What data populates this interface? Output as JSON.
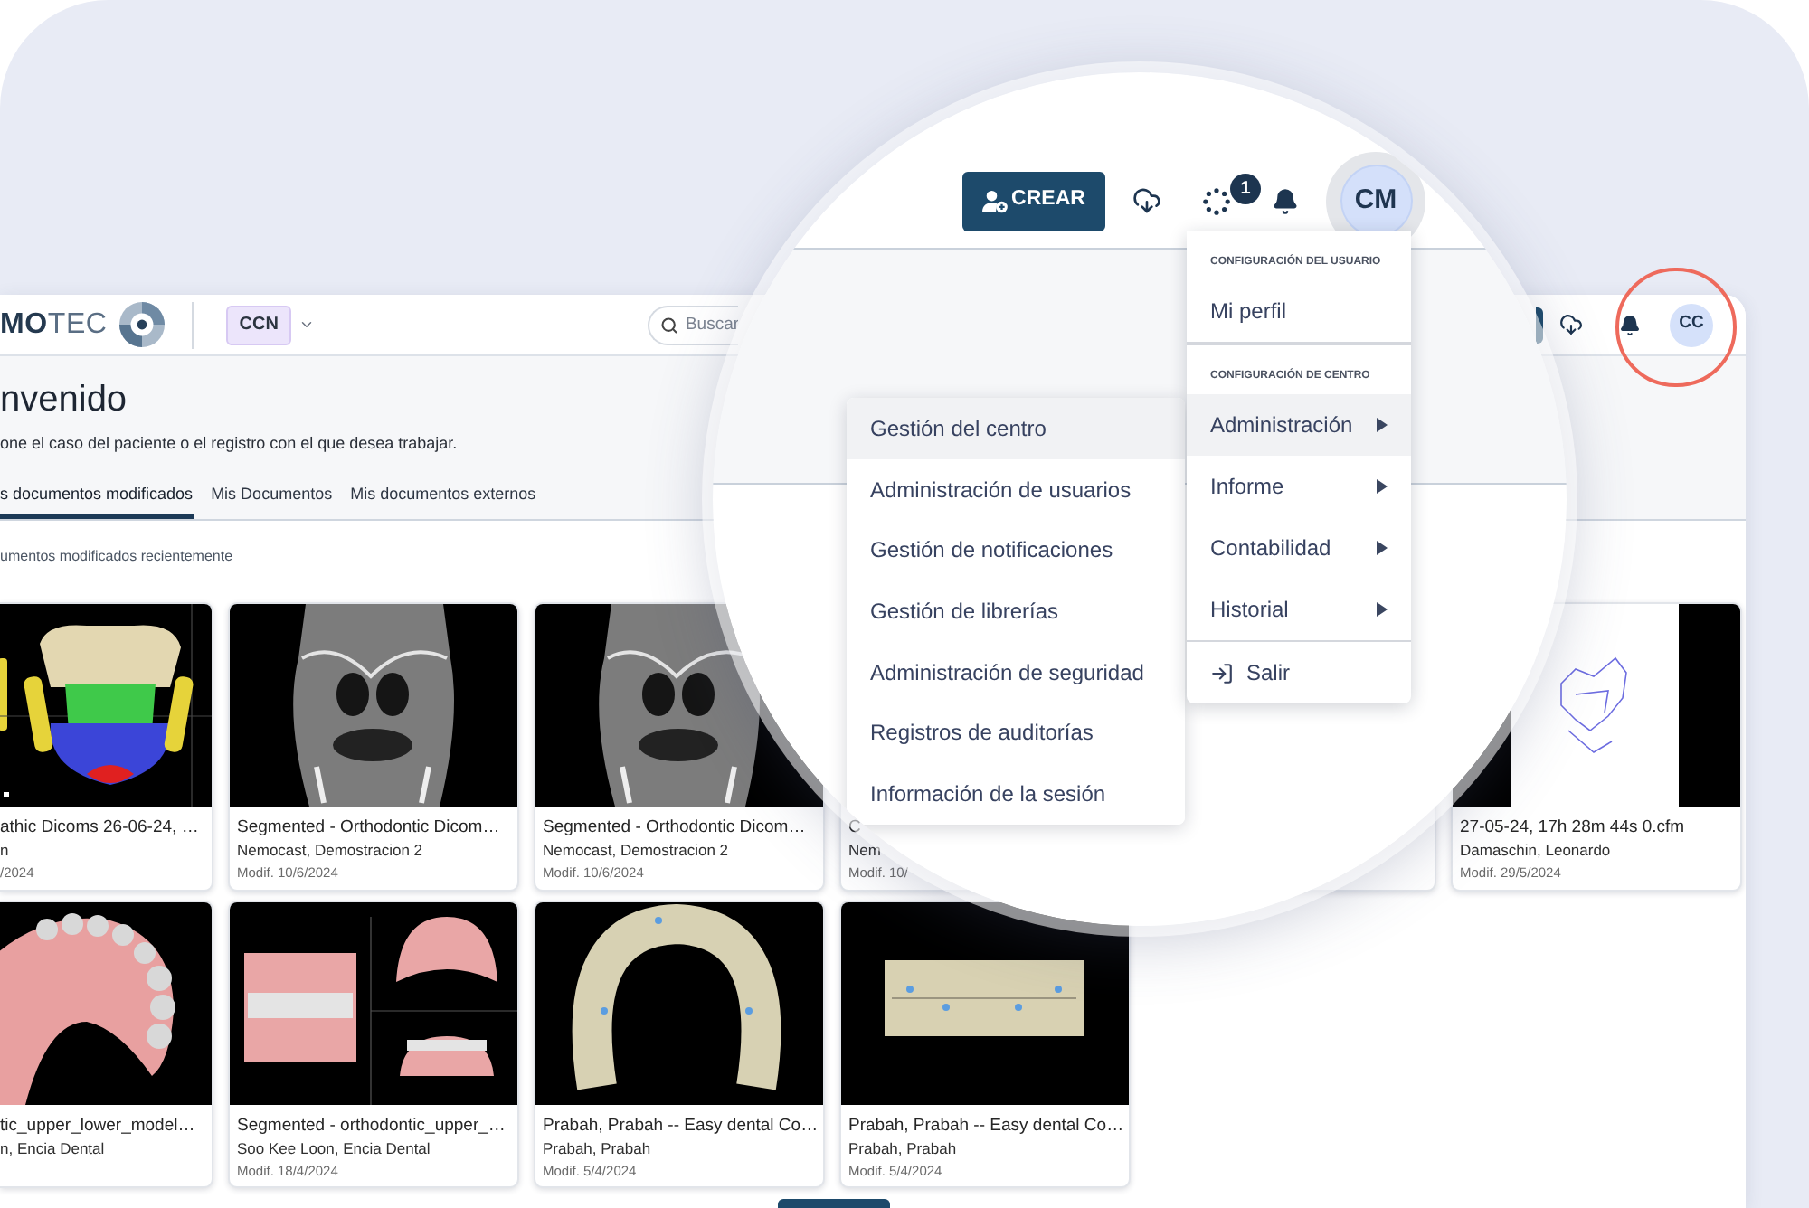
{
  "app": {
    "logo": {
      "text": "**MO**TEC"
    },
    "center_selector": {
      "label": "CCN"
    },
    "search": {
      "placeholder": "Buscar"
    },
    "user_avatar": {
      "initials": "CC",
      "highlighted": true
    },
    "welcome": {
      "title": "nvenido",
      "subtitle": "one el caso del paciente o el registro con el que desea trabajar."
    },
    "tabs": [
      {
        "label": "s documentos modificados",
        "selected": true
      },
      {
        "label": "Mis Documentos",
        "selected": false
      },
      {
        "label": "Mis documentos externos",
        "selected": false
      }
    ],
    "section_title": "umentos modificados recientemente",
    "card_rows": [
      [
        {
          "kind": "skull",
          "title": "athic Dicoms 26-06-24, …",
          "author": "n",
          "date": "/2024"
        },
        {
          "kind": "ct",
          "title": "Segmented - Orthodontic Dicom…",
          "author": "Nemocast, Demostracion 2",
          "date": "Modif. 10/6/2024"
        },
        {
          "kind": "ct",
          "title": "Segmented - Orthodontic Dicom…",
          "author": "Nemocast, Demostracion 2",
          "date": "Modif. 10/6/2024"
        },
        {
          "title": "C",
          "author": "Nem",
          "date": "Modif. 10/"
        },
        {},
        {
          "kind": "tracing",
          "title": "27-05-24, 17h 28m 44s 0.cfm",
          "author": "Damaschin, Leonardo",
          "date": "Modif. 29/5/2024"
        }
      ],
      [
        {
          "kind": "arch",
          "title": "tic_upper_lower_model…",
          "author": "n, Encia Dental"
        },
        {
          "kind": "views",
          "title": "Segmented - orthodontic_upper_…",
          "author": "Soo Kee Loon, Encia Dental",
          "date": "Modif. 18/4/2024"
        },
        {
          "kind": "aligner",
          "title": "Prabah, Prabah -- Easy dental Co…",
          "author": "Prabah, Prabah",
          "date": "Modif. 5/4/2024"
        },
        {
          "kind": "front",
          "title": "Prabah, Prabah -- Easy dental Co…",
          "author": "Prabah, Prabah",
          "date": "Modif. 5/4/2024"
        }
      ]
    ]
  },
  "magnifier": {
    "create_button": {
      "label": "CREAR"
    },
    "sync_badge": "1",
    "avatar": {
      "initials": "CM"
    },
    "user_menu": {
      "sections": [
        {
          "heading": "CONFIGURACIÓN DEL USUARIO",
          "items": [
            {
              "label": "Mi perfil",
              "has_submenu": false,
              "selected": false
            }
          ]
        },
        {
          "heading": "CONFIGURACIÓN DE CENTRO",
          "items": [
            {
              "label": "Administración",
              "has_submenu": true,
              "selected": true
            },
            {
              "label": "Informe",
              "has_submenu": true,
              "selected": false
            },
            {
              "label": "Contabilidad",
              "has_submenu": true,
              "selected": false
            },
            {
              "label": "Historial",
              "has_submenu": true,
              "selected": false
            }
          ]
        }
      ],
      "exit_item": {
        "label": "Salir"
      }
    },
    "submenu": {
      "items": [
        {
          "label": "Gestión del centro",
          "selected": true
        },
        {
          "label": "Administración de usuarios",
          "selected": false
        },
        {
          "label": "Gestión de notificaciones",
          "selected": false
        },
        {
          "label": "Gestión de librerías",
          "selected": false
        },
        {
          "label": "Administración de seguridad",
          "selected": false
        },
        {
          "label": "Registros de auditorías",
          "selected": false
        },
        {
          "label": "Información de la sesión",
          "selected": false
        }
      ]
    }
  }
}
